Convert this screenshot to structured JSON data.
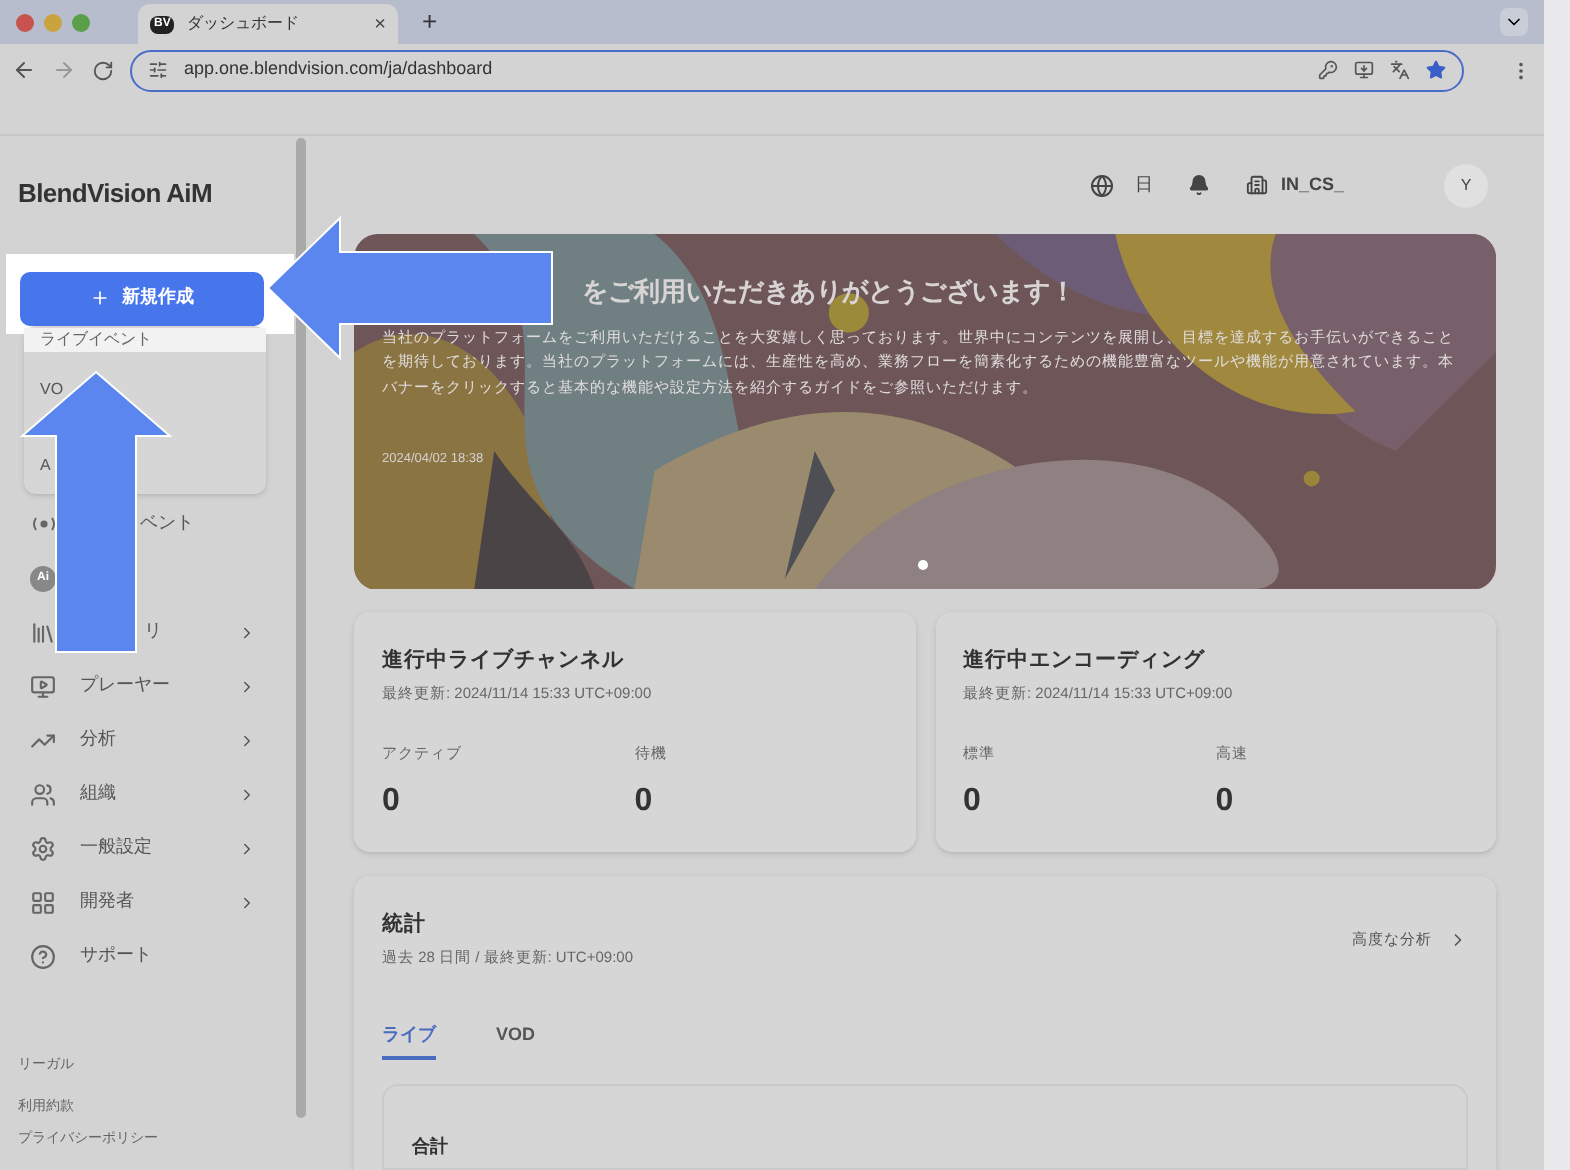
{
  "browser": {
    "tab_title": "ダッシュボード",
    "tab_favicon": "BV",
    "url": "app.one.blendvision.com/ja/dashboard",
    "new_tab": "+",
    "close_tab": "×"
  },
  "sidebar": {
    "logo": "BlendVision AiM",
    "create_button": "新規作成",
    "create_menu": [
      {
        "label": "ライブイベント",
        "selected": true
      },
      {
        "label": "VO",
        "selected": false
      },
      {
        "label": "A",
        "selected": false
      }
    ],
    "items": [
      {
        "label": "ベント",
        "has_submenu": false
      },
      {
        "icon_text": "Ai",
        "has_submenu": false
      },
      {
        "label": "リ",
        "has_submenu": true
      },
      {
        "label": "プレーヤー",
        "has_submenu": true
      },
      {
        "label": "分析",
        "has_submenu": true
      },
      {
        "label": "組織",
        "has_submenu": true
      },
      {
        "label": "一般設定",
        "has_submenu": true
      },
      {
        "label": "開発者",
        "has_submenu": true
      },
      {
        "label": "サポート",
        "has_submenu": false
      }
    ],
    "footer": [
      "リーガル",
      "利用約款",
      "プライバシーポリシー"
    ]
  },
  "header": {
    "language": "日",
    "workspace": "IN_CS_",
    "avatar": "Y"
  },
  "banner": {
    "title": "をご利用いただきありがとうございます！",
    "body": "当社のプラットフォームをご利用いただけることを大変嬉しく思っております。世界中にコンテンツを展開し、目標を達成するお手伝いができることを期待しております。当社のプラットフォームには、生産性を高め、業務フローを簡素化するための機能豊富なツールや機能が用意されています。本バナーをクリックすると基本的な機能や設定方法を紹介するガイドをご参照いただけます。",
    "date": "2024/04/02 18:38"
  },
  "status_cards": [
    {
      "title": "進行中ライブチャンネル",
      "updated": "最終更新: 2024/11/14 15:33 UTC+09:00",
      "metrics": [
        {
          "label": "アクティブ",
          "value": "0"
        },
        {
          "label": "待機",
          "value": "0"
        }
      ]
    },
    {
      "title": "進行中エンコーディング",
      "updated": "最終更新: 2024/11/14 15:33 UTC+09:00",
      "metrics": [
        {
          "label": "標準",
          "value": "0"
        },
        {
          "label": "高速",
          "value": "0"
        }
      ]
    }
  ],
  "stats": {
    "title": "統計",
    "subtitle": "過去 28 日間 / 最終更新: UTC+09:00",
    "advanced_link": "高度な分析",
    "tabs": [
      {
        "label": "ライブ",
        "selected": true
      },
      {
        "label": "VOD",
        "selected": false
      }
    ],
    "total_title": "合計"
  }
}
